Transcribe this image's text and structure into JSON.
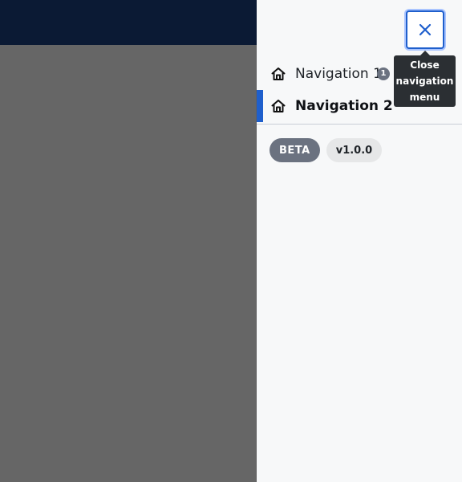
{
  "header": {
    "topbar_color": "#0b1a34"
  },
  "overlay": {
    "scrim_color": "#666666"
  },
  "drawer": {
    "close_button": {
      "icon": "close-icon",
      "tooltip_lines": [
        "Close",
        "navigation",
        "menu"
      ]
    },
    "nav_items": [
      {
        "label": "Navigation 1",
        "icon": "home-icon",
        "badge": "1",
        "active": false
      },
      {
        "label": "Navigation 2",
        "icon": "home-icon",
        "badge": "",
        "active": true
      }
    ],
    "tags": {
      "beta": "BETA",
      "version": "v1.0.0"
    }
  },
  "colors": {
    "accent": "#1f5fcc",
    "badge_gray": "#6b7280",
    "tooltip_bg": "#2b2f33",
    "drawer_bg": "#f7f8f9"
  }
}
